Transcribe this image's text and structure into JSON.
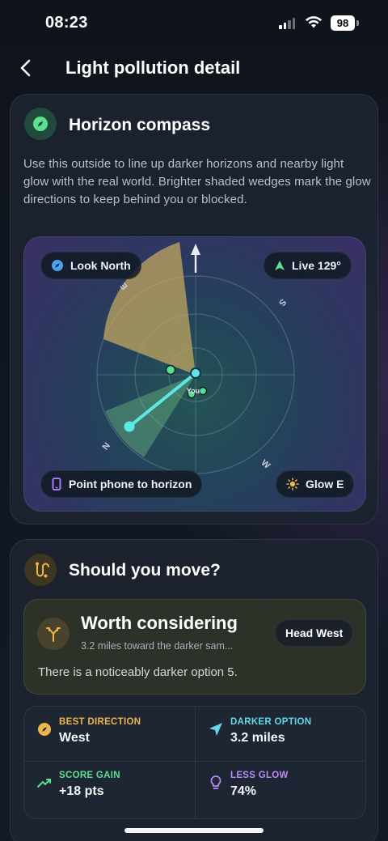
{
  "status_bar": {
    "time": "08:23",
    "battery": "98"
  },
  "header": {
    "title": "Light pollution detail"
  },
  "compass_card": {
    "title": "Horizon compass",
    "description": "Use this outside to line up darker horizons and nearby light glow with the real world. Brighter shaded wedges mark the glow directions to keep behind you or blocked.",
    "look_north_label": "Look North",
    "live_heading_label": "Live 129°",
    "point_phone_label": "Point phone to horizon",
    "glow_label": "Glow E",
    "compass_letters": [
      "N",
      "E",
      "S",
      "W"
    ],
    "center_label": "You"
  },
  "move_card": {
    "title": "Should you move?",
    "verdict": {
      "title": "Worth considering",
      "subtitle": "3.2 miles toward the darker sam...",
      "text": "There is a noticeably darker option 5.",
      "action_label": "Head West"
    },
    "stats": [
      {
        "label": "BEST DIRECTION",
        "value": "West",
        "color": "#f0b54a",
        "icon": "compass-icon"
      },
      {
        "label": "DARKER OPTION",
        "value": "3.2 miles",
        "color": "#62d8e8",
        "icon": "navigation-arrow-icon"
      },
      {
        "label": "SCORE GAIN",
        "value": "+18 pts",
        "color": "#5be08e",
        "icon": "trend-up-icon"
      },
      {
        "label": "LESS GLOW",
        "value": "74%",
        "color": "#b98cf2",
        "icon": "lightbulb-icon"
      }
    ]
  },
  "colors": {
    "accent_green": "#5be08e",
    "accent_cyan": "#5de8e8",
    "glow_wedge": "#c8aa60"
  }
}
